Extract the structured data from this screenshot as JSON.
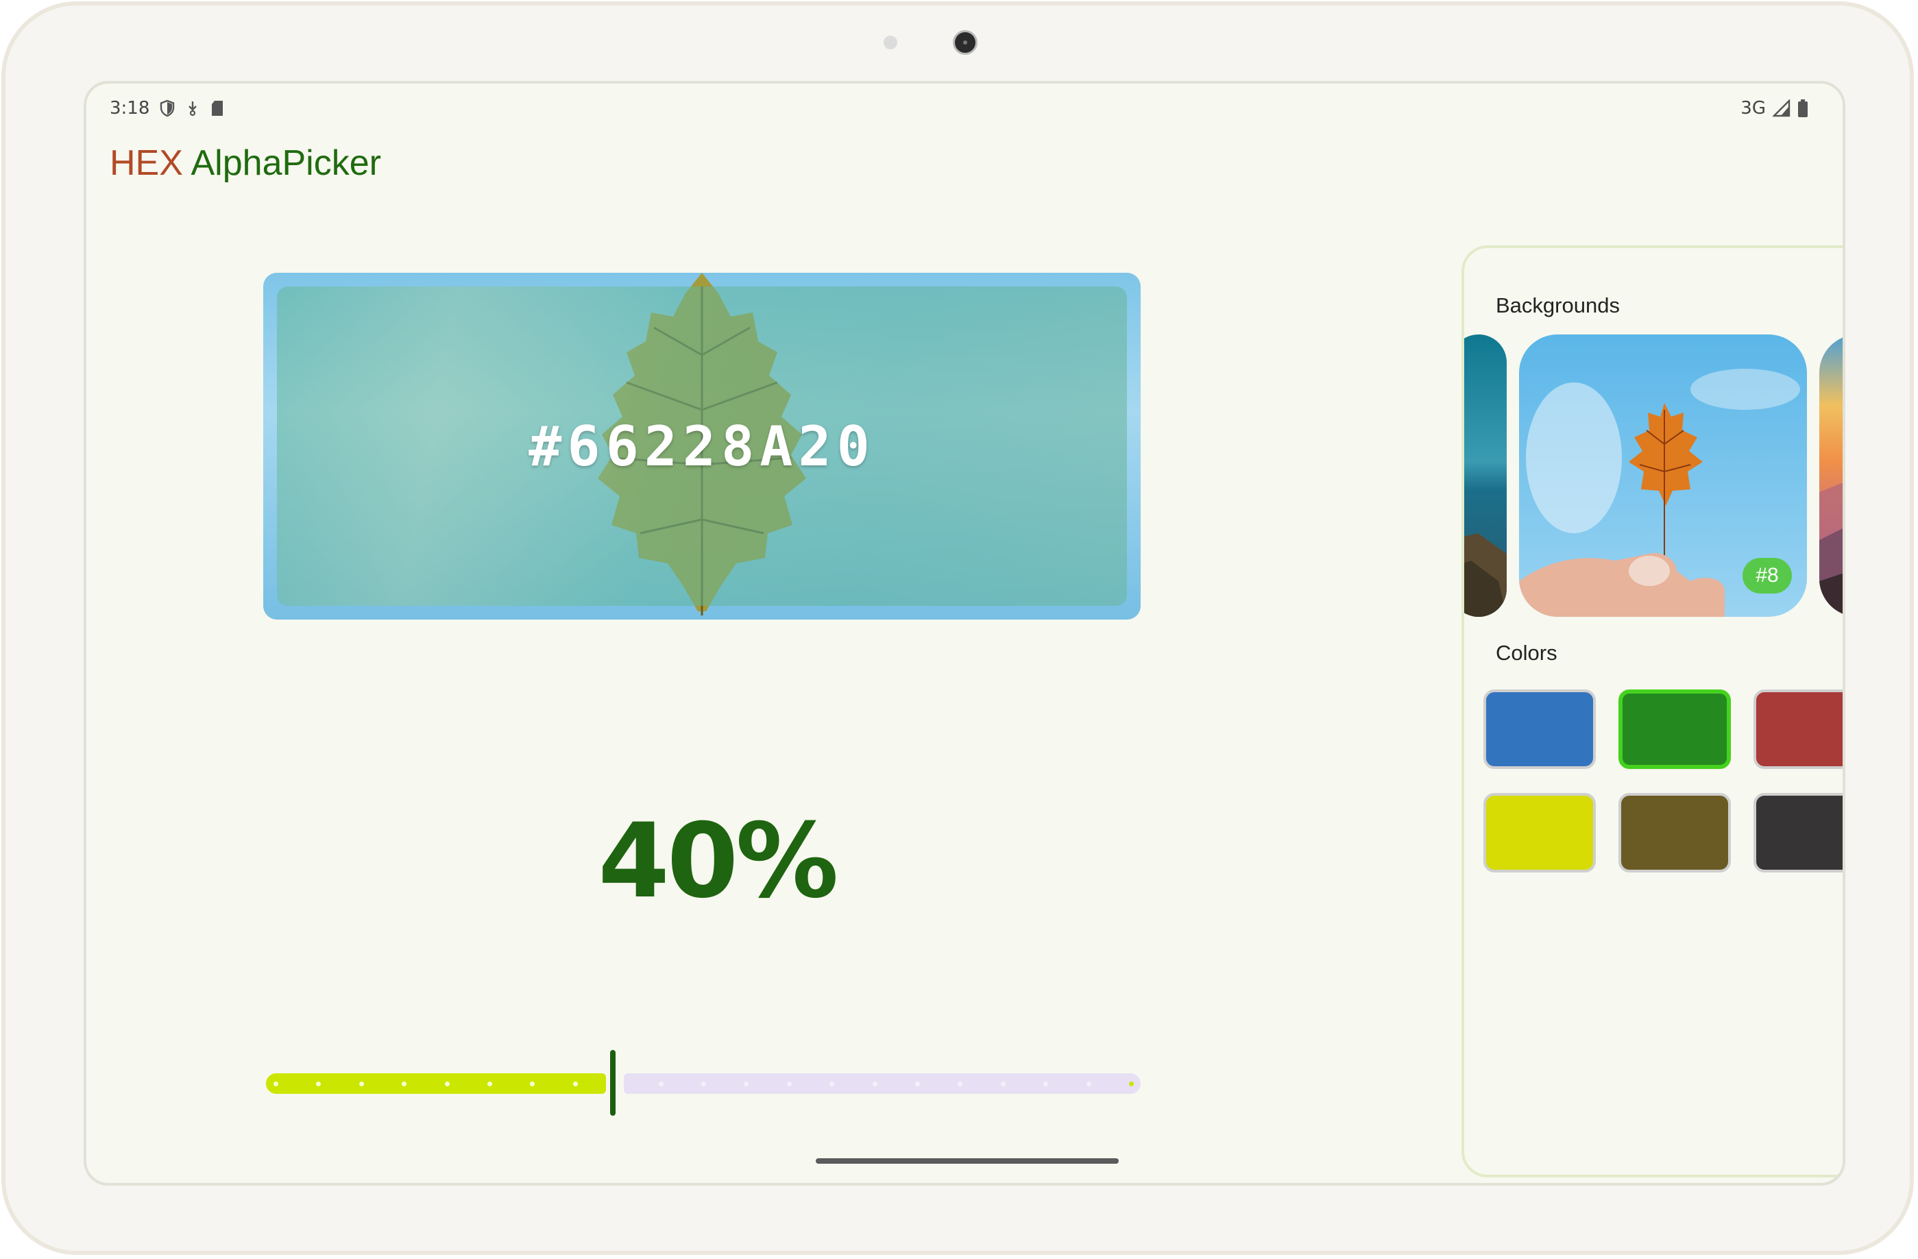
{
  "status_bar": {
    "time": "3:18",
    "network": "3G",
    "icons_left": [
      "shield-icon",
      "download-icon",
      "sd-card-icon"
    ],
    "icons_right": [
      "signal-icon",
      "battery-icon"
    ]
  },
  "app_title": {
    "part1": "HEX",
    "part2": " AlphaPicker"
  },
  "preview": {
    "hex_value": "#66228A20"
  },
  "alpha": {
    "percent_label": "40%",
    "value_fraction": 0.4,
    "step_count": 20
  },
  "panel": {
    "backgrounds_label": "Backgrounds",
    "colors_label": "Colors",
    "backgrounds": [
      {
        "name": "ocean-cliff-background",
        "badge": ""
      },
      {
        "name": "autumn-leaf-background",
        "badge": "#8",
        "selected": true
      },
      {
        "name": "sunset-mountains-background",
        "badge": ""
      }
    ],
    "colors": [
      {
        "name": "blue",
        "hex": "#3374bf",
        "selected": false
      },
      {
        "name": "green",
        "hex": "#248a20",
        "selected": true
      },
      {
        "name": "red",
        "hex": "#a83a38",
        "selected": false
      },
      {
        "name": "yellow",
        "hex": "#d6dc04",
        "selected": false
      },
      {
        "name": "olive-brown",
        "hex": "#6a5a24",
        "selected": false
      },
      {
        "name": "dark-gray",
        "hex": "#363434",
        "selected": false
      }
    ]
  },
  "colors": {
    "title_hex": "#b34a27",
    "title_name": "#1f6b10",
    "slider_active": "#cbe600",
    "slider_inactive": "#e7e0f4",
    "thumb": "#1e5e10"
  }
}
